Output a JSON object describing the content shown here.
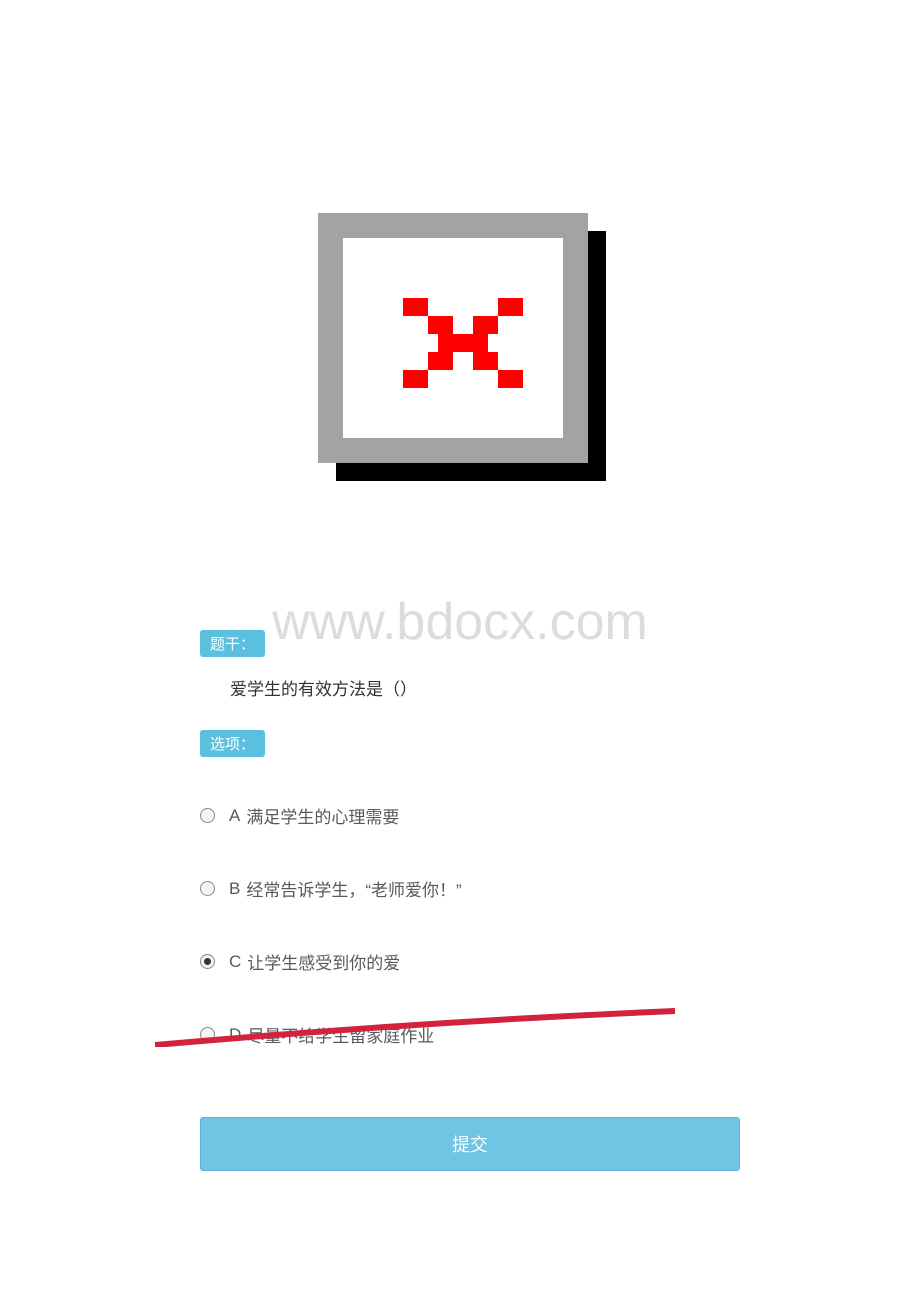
{
  "watermark": "www.bdocx.com",
  "labels": {
    "question_tag": "题干：",
    "options_tag": "选项："
  },
  "question": "爱学生的有效方法是（）",
  "options": [
    {
      "letter": "A",
      "text": "满足学生的心理需要",
      "selected": false
    },
    {
      "letter": "B",
      "text": "经常告诉学生，“老师爱你！”",
      "selected": false
    },
    {
      "letter": "C",
      "text": "让学生感受到你的爱",
      "selected": true
    },
    {
      "letter": "D",
      "text": "尽量不给学生留家庭作业",
      "selected": false
    }
  ],
  "submit_label": "提交"
}
